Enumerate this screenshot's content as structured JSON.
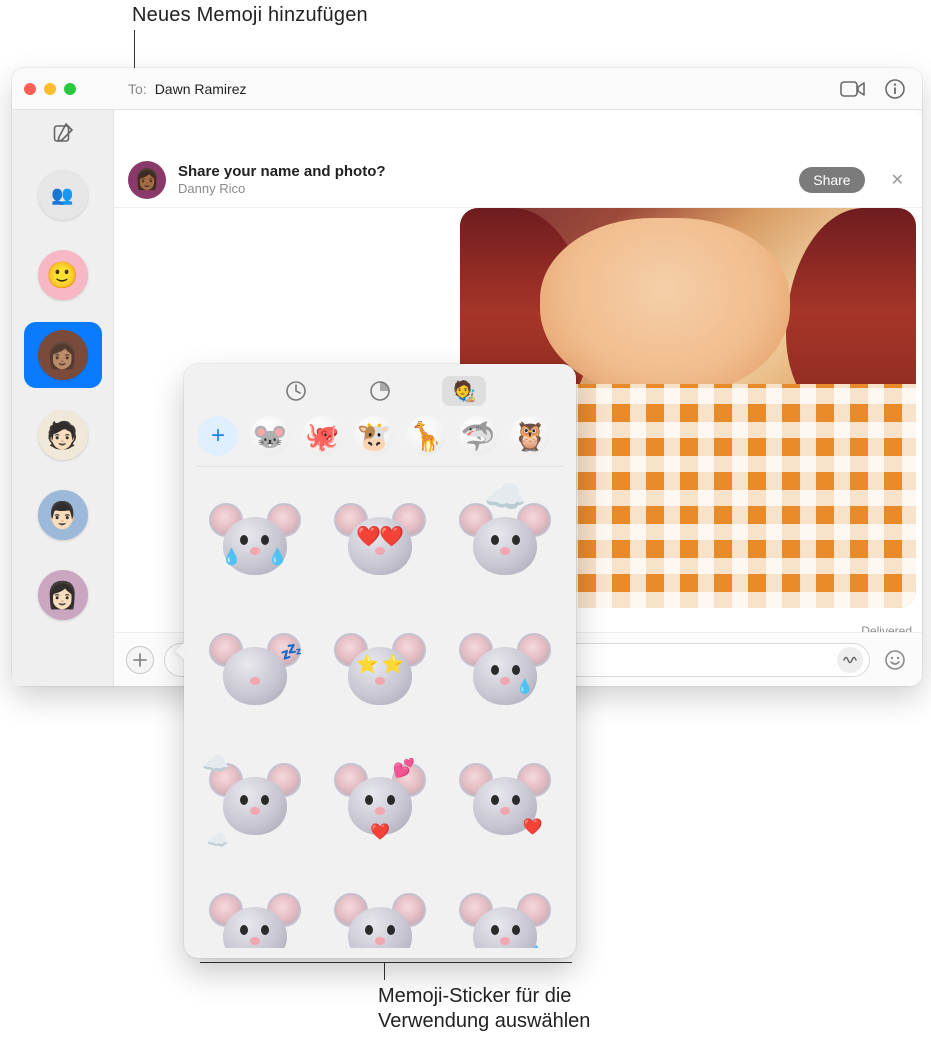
{
  "callouts": {
    "top": "Neues Memoji hinzufügen",
    "bottom": "Memoji-Sticker für die\nVerwendung auswählen"
  },
  "header": {
    "to_label": "To:",
    "to_name": "Dawn Ramirez",
    "icons": {
      "facetime": "facetime-icon",
      "info": "info-icon"
    }
  },
  "share_banner": {
    "title": "Share your name and photo?",
    "subtitle": "Danny Rico",
    "button": "Share"
  },
  "message": {
    "delivered": "Delivered",
    "input_placeholder": ""
  },
  "sidebar": {
    "items": [
      {
        "kind": "group",
        "selected": false
      },
      {
        "kind": "person",
        "selected": false,
        "tone": "#f7b7c5"
      },
      {
        "kind": "person",
        "selected": true,
        "tone": "#7a4a3a"
      },
      {
        "kind": "person",
        "selected": false,
        "tone": "#f0e8d8"
      },
      {
        "kind": "person",
        "selected": false,
        "tone": "#9cb9d9"
      },
      {
        "kind": "person",
        "selected": false,
        "tone": "#caa6c0"
      }
    ]
  },
  "popover": {
    "tabs": [
      {
        "name": "recents",
        "icon": "clock-icon",
        "selected": false
      },
      {
        "name": "stickers",
        "icon": "sticker-icon",
        "selected": false
      },
      {
        "name": "memoji",
        "icon": "memoji-icon",
        "selected": true
      }
    ],
    "animoji_row": [
      {
        "kind": "add",
        "label": "+"
      },
      {
        "kind": "animoji",
        "emoji": "🐭",
        "name": "mouse"
      },
      {
        "kind": "animoji",
        "emoji": "🐙",
        "name": "octopus"
      },
      {
        "kind": "animoji",
        "emoji": "🐮",
        "name": "cow"
      },
      {
        "kind": "animoji",
        "emoji": "🦒",
        "name": "giraffe"
      },
      {
        "kind": "animoji",
        "emoji": "🦈",
        "name": "shark"
      },
      {
        "kind": "animoji",
        "emoji": "🦉",
        "name": "owl"
      }
    ],
    "stickers": [
      {
        "name": "mouse-laughing-tears",
        "overlay": "tears"
      },
      {
        "name": "mouse-heart-eyes",
        "overlay": "hearts"
      },
      {
        "name": "mouse-mind-blown",
        "overlay": "explode"
      },
      {
        "name": "mouse-sleeping",
        "overlay": "zzz"
      },
      {
        "name": "mouse-star-eyes",
        "overlay": "stars"
      },
      {
        "name": "mouse-crying",
        "overlay": "tear1"
      },
      {
        "name": "mouse-head-in-clouds",
        "overlay": "clouds"
      },
      {
        "name": "mouse-kisses",
        "overlay": "kisses"
      },
      {
        "name": "mouse-loving",
        "overlay": "heart1"
      },
      {
        "name": "mouse-worried",
        "overlay": ""
      },
      {
        "name": "mouse-angry",
        "overlay": ""
      },
      {
        "name": "mouse-sweat",
        "overlay": "sweat"
      }
    ]
  },
  "colors": {
    "accent": "#0a7bff",
    "share_button": "#7b7b7b"
  }
}
